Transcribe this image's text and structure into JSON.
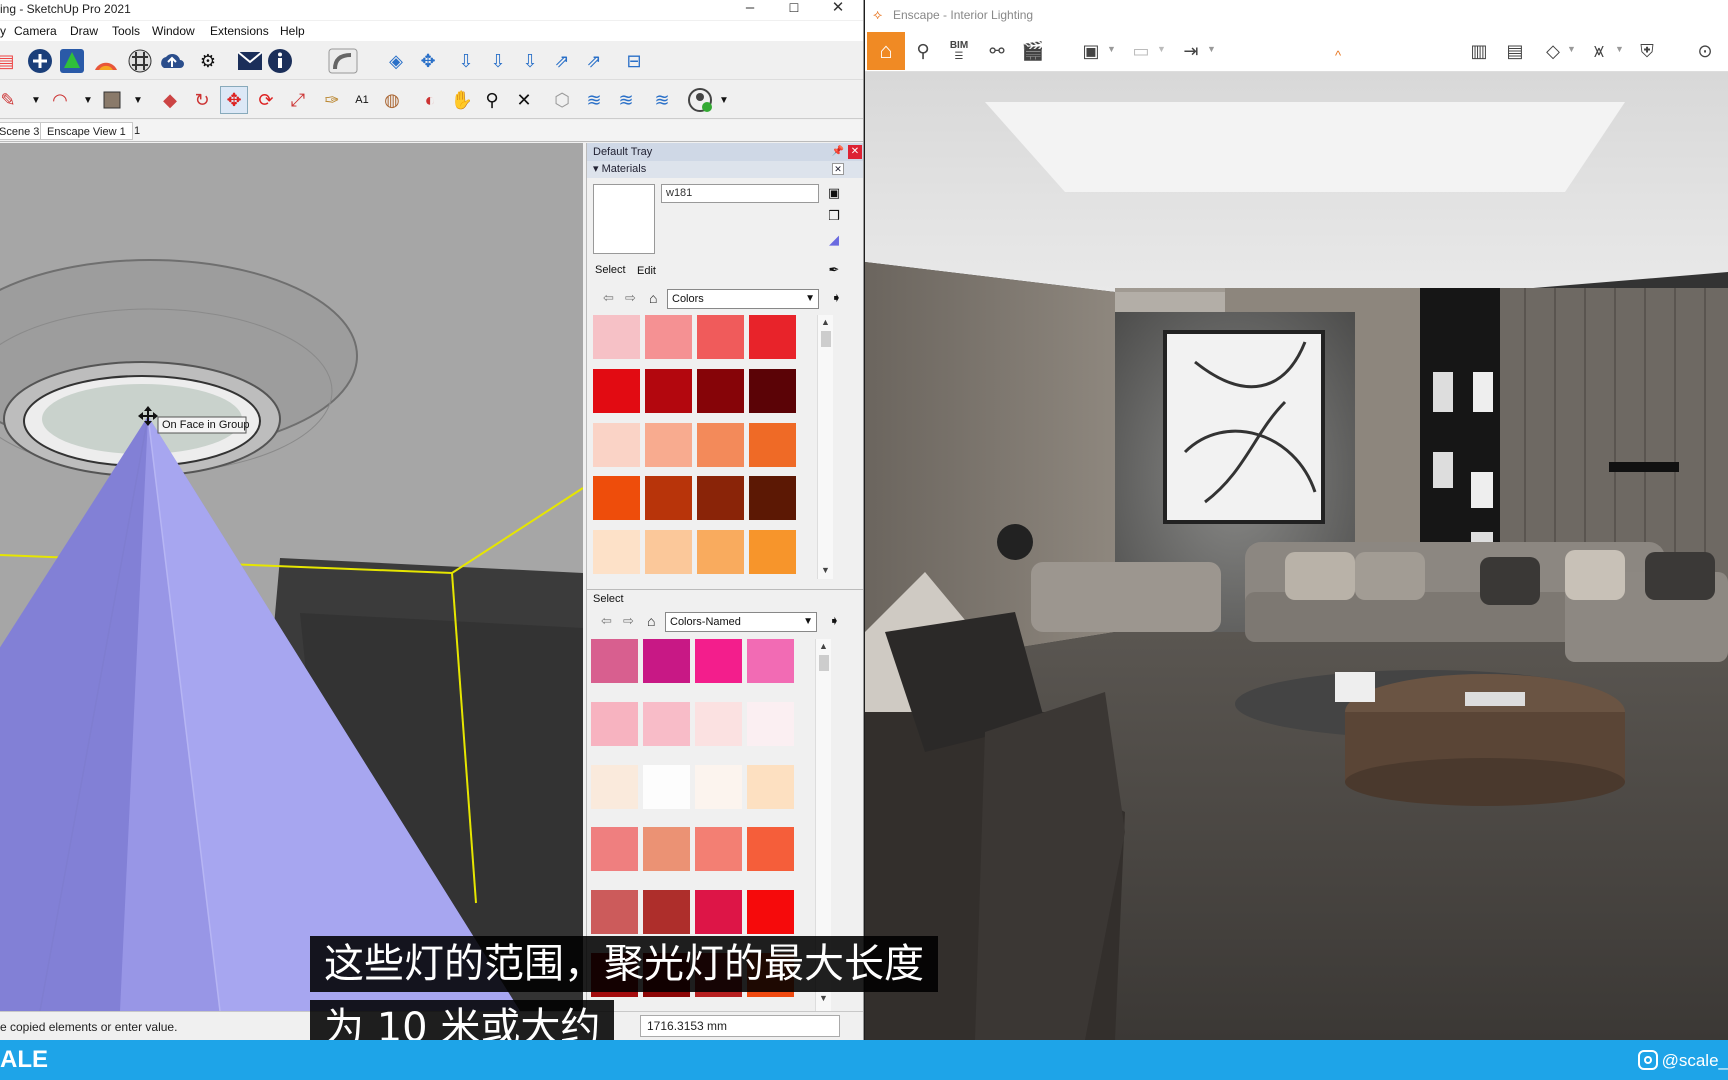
{
  "sketchup": {
    "title": "ing - SketchUp Pro 2021",
    "window_controls": {
      "minimize": "–",
      "maximize": "☐",
      "close": "✕"
    },
    "menu": [
      "Camera",
      "Draw",
      "Tools",
      "Window",
      "Extensions",
      "Help"
    ],
    "scene_tabs": [
      "Scene 3",
      "Enscape View 1",
      "1"
    ],
    "viewport": {
      "inference_tooltip": "On Face in Group",
      "guide_color": "#e6e600",
      "cone_color": "#9a98e8"
    },
    "status": {
      "message": "e copied elements or enter value.",
      "measurements_value": "1716.3153 mm"
    }
  },
  "tray": {
    "title": "Default Tray",
    "materials_section": "Materials",
    "material_name": "w181",
    "tabs": {
      "select": "Select",
      "edit": "Edit"
    },
    "browser1": {
      "library": "Colors",
      "swatches": [
        "#f6c1c6",
        "#f59193",
        "#f05b5b",
        "#e8232a",
        "#e20b12",
        "#b3070e",
        "#860408",
        "#5b0306",
        "#fad3c6",
        "#f8ab8f",
        "#f38a5a",
        "#ef6a26",
        "#ee4d0b",
        "#b8340a",
        "#8a2408",
        "#5c1804",
        "#fde1c8",
        "#fbc89a",
        "#f9ab5e",
        "#f7952b"
      ]
    },
    "browser2": {
      "label": "Select",
      "library": "Colors-Named",
      "swatches": [
        "#d85f8f",
        "#c81885",
        "#f31e8c",
        "#f26bb4",
        "#f7b3c0",
        "#f8bcc8",
        "#fbe1e1",
        "#fbeff2",
        "#faeadc",
        "#fdfdfd",
        "#fcf4ee",
        "#fde0c1",
        "#ef7f7f",
        "#eb9274",
        "#f37f73",
        "#f55e3a",
        "#cc5b5b",
        "#ae2e2b",
        "#dd1547",
        "#f60a0b",
        "#a30c0d",
        "#8c0606",
        "#b72020",
        "#f04a10"
      ]
    }
  },
  "enscape": {
    "title": "Enscape - Interior Lighting",
    "toolbar_icons": [
      "home-icon",
      "pin-icon",
      "bim-icon",
      "binoculars-icon",
      "clapper-icon",
      "render-image-icon",
      "batch-render-icon",
      "export-icon",
      "map-icon",
      "panorama-icon",
      "view-cube-icon",
      "people-icon",
      "settings-icon",
      "vr-icon"
    ],
    "bim_label": "BIM",
    "accent": "#f08a24"
  },
  "subtitles": {
    "line1": "这些灯的范围，聚光灯的最大长度",
    "line2": "为 10 米或大约"
  },
  "bottom_bar": {
    "brand": "ALE",
    "handle": "@scale_",
    "color": "#1ea4e8"
  }
}
